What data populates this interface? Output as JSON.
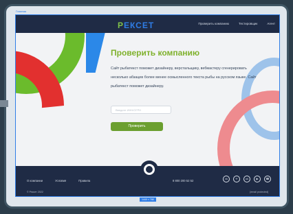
{
  "frame": {
    "label": "Главная",
    "size_badge": "1440 × 768"
  },
  "header": {
    "logo_first": "Р",
    "logo_rest": "ЕКСЕТ",
    "nav": [
      "Проверить компанию",
      "Тестировщик",
      "Агент"
    ]
  },
  "main": {
    "title": "Проверить компанию",
    "description": "Сайт рыбатекст поможет дизайнеру, верстальщику, вебмастеру сгенерировать несколько абзацев более менее осмысленного текста рыбы на русском языке. Сайт рыбатекст поможет дизайнеру.",
    "input_placeholder": "Введите ИНН/ОГРН",
    "button_label": "Проверить"
  },
  "footer": {
    "links": [
      "О компании",
      "Условия",
      "Правила"
    ],
    "phone": "8 800 200 52 52",
    "copyright": "© Рексет 2022",
    "email": "[email protected]",
    "social_icons": [
      "vk-icon",
      "telegram-icon",
      "ok-icon",
      "youtube-icon",
      "whatsapp-icon"
    ]
  },
  "colors": {
    "accent_green": "#7fb12c",
    "brand_blue": "#2f7de6",
    "dark_navy": "#1f2b45"
  }
}
